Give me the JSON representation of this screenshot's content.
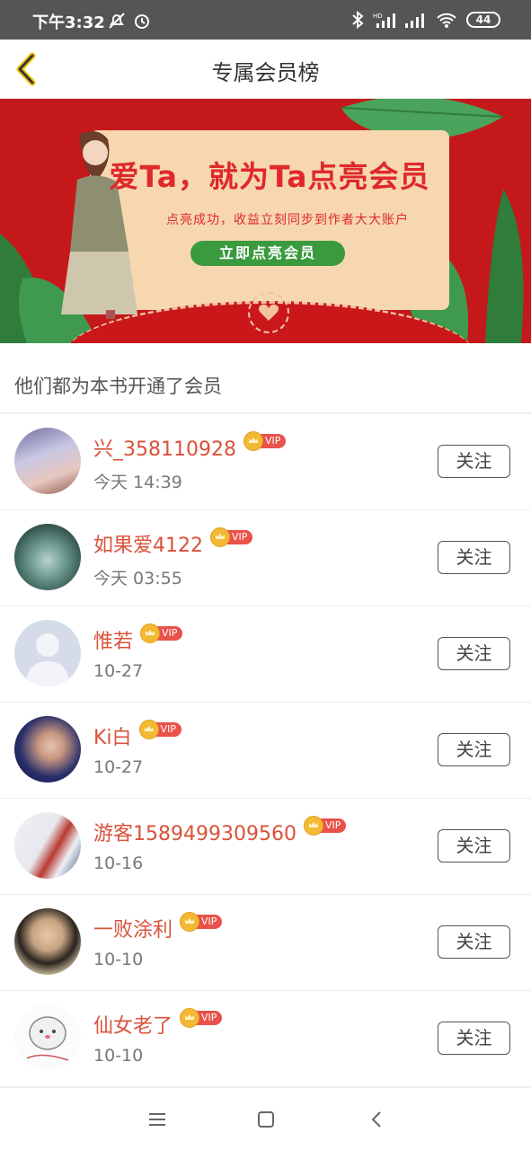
{
  "status_bar": {
    "time": "下午3:32",
    "icons": [
      "mute-icon",
      "alarm-icon",
      "bluetooth-icon",
      "hd-signal-icon",
      "signal-icon",
      "wifi-icon"
    ],
    "battery": "44"
  },
  "header": {
    "title": "专属会员榜"
  },
  "banner": {
    "title": "爱Ta，就为Ta点亮会员",
    "subtitle": "点亮成功，收益立刻同步到作者大大账户",
    "button": "立即点亮会员"
  },
  "section_title": "他们都为本书开通了会员",
  "vip_tag": "VIP",
  "follow_label": "关注",
  "members": [
    {
      "name": "兴_358110928",
      "time": "今天 14:39"
    },
    {
      "name": "如果爱4122",
      "time": "今天 03:55"
    },
    {
      "name": "惟若",
      "time": "10-27"
    },
    {
      "name": "Ki白",
      "time": "10-27"
    },
    {
      "name": "游客1589499309560",
      "time": "10-16"
    },
    {
      "name": "一败涂利",
      "time": "10-10"
    },
    {
      "name": "仙女老了",
      "time": "10-10"
    }
  ],
  "colors": {
    "accent": "#d9523b",
    "banner_red": "#c5181a",
    "vip_red": "#e8524a",
    "vip_gold": "#f3b935",
    "banner_green": "#3a9a3e"
  }
}
